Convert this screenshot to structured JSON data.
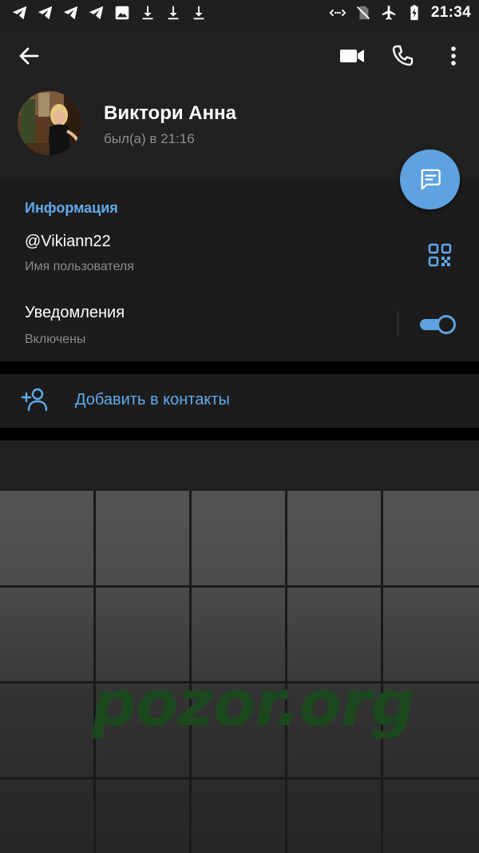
{
  "status_bar": {
    "time": "21:34",
    "left_icons": [
      "telegram-icon",
      "telegram-icon",
      "telegram-icon",
      "telegram-icon",
      "image-icon",
      "download-icon",
      "download-icon",
      "download-icon"
    ],
    "right_icons": [
      "data-saver-icon",
      "no-sim-icon",
      "airplane-icon",
      "battery-charging-icon"
    ]
  },
  "header": {
    "back_icon": "arrow-left-icon",
    "video_icon": "video-camera-icon",
    "call_icon": "phone-icon",
    "more_icon": "more-vertical-icon"
  },
  "profile": {
    "name": "Виктори Анна",
    "status": "был(а) в 21:16"
  },
  "fab": {
    "icon": "message-icon"
  },
  "info": {
    "title": "Информация",
    "username": "@Vikiann22",
    "username_label": "Имя пользователя",
    "notifications": "Уведомления",
    "notifications_status": "Включены",
    "notifications_enabled": true
  },
  "actions": {
    "add_contact": "Добавить в контакты"
  },
  "watermark": "pozor.org",
  "colors": {
    "accent": "#5ea3e0",
    "link": "#61aaec",
    "header_bg": "#212121",
    "section_bg": "#1c1c1c",
    "watermark": "#1b4a1e"
  }
}
